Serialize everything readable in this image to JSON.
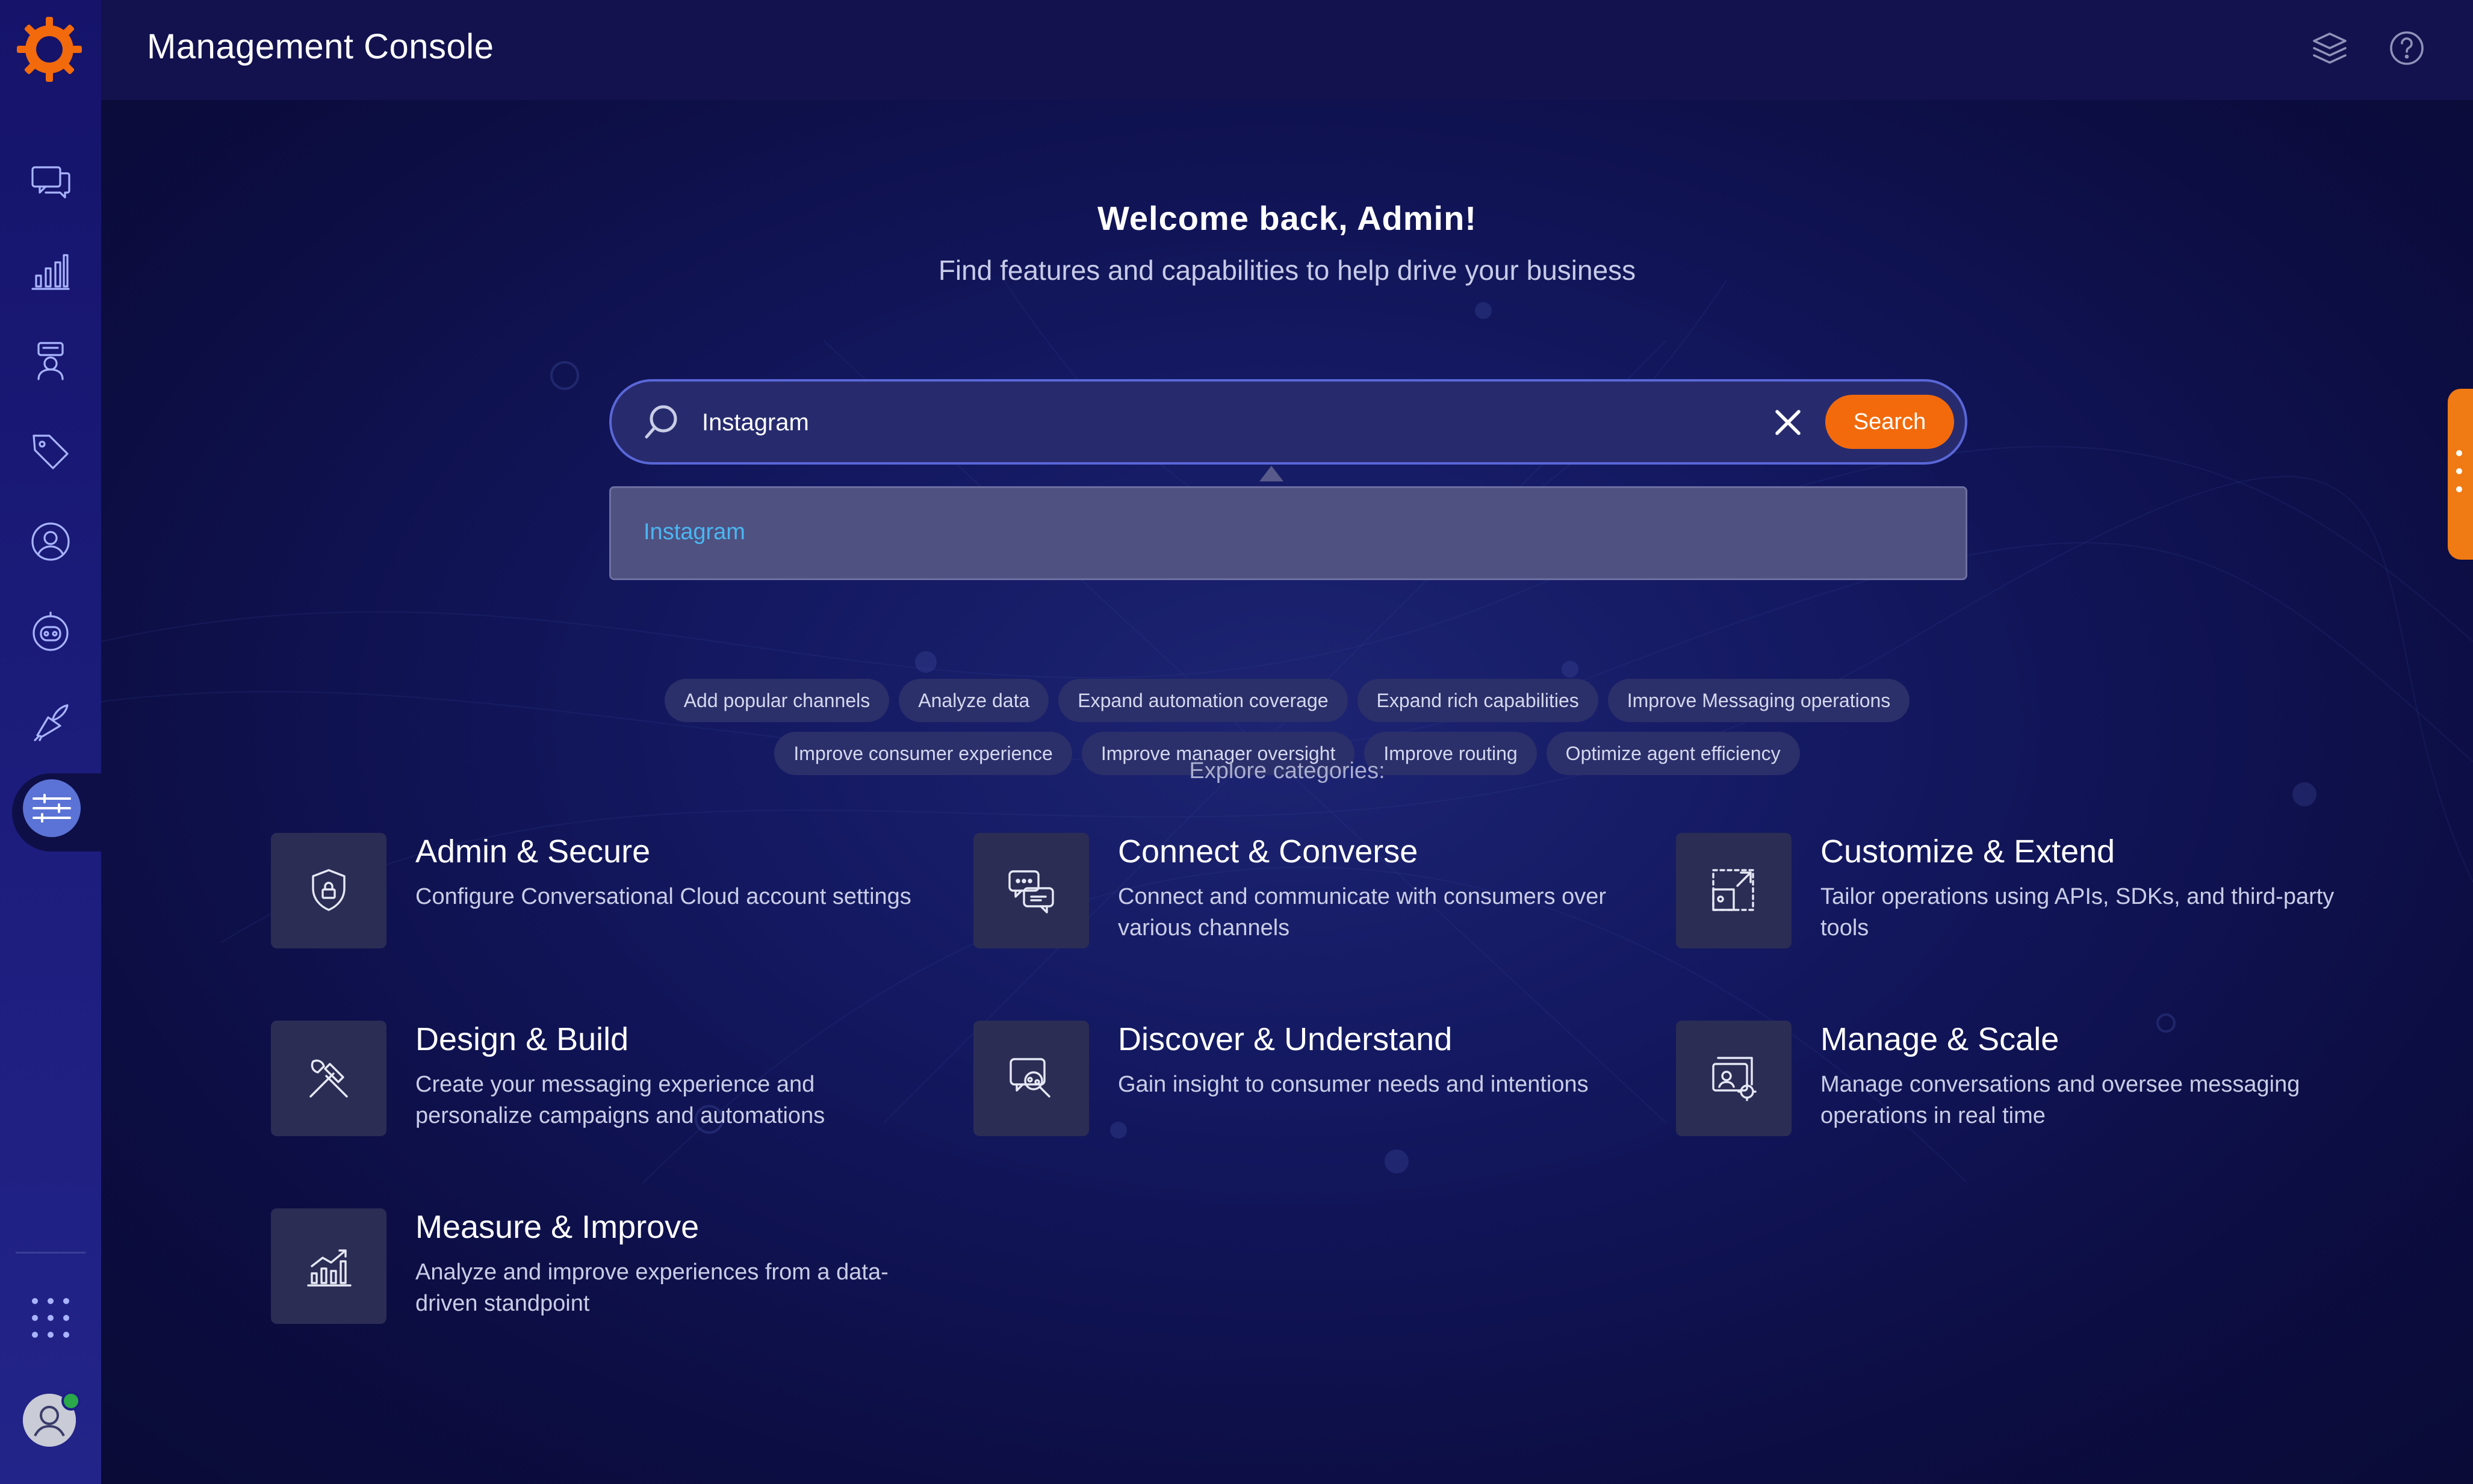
{
  "app": {
    "title": "Management Console"
  },
  "colors": {
    "accent": "#f26a0c",
    "link": "#4bb6f2",
    "sidebar": "#1a1a78",
    "background": "#0d0f3f"
  },
  "sidebar": {
    "items": [
      {
        "icon": "conversations-icon"
      },
      {
        "icon": "analytics-icon"
      },
      {
        "icon": "agent-workspace-icon"
      },
      {
        "icon": "tag-icon"
      },
      {
        "icon": "users-icon"
      },
      {
        "icon": "bot-icon"
      },
      {
        "icon": "campaigns-icon"
      },
      {
        "icon": "management-sliders-icon",
        "active": true
      }
    ],
    "bottom": [
      "apps-grid-icon",
      "user-avatar"
    ]
  },
  "topbar": {
    "icons": [
      "layers-icon",
      "help-icon"
    ]
  },
  "welcome": {
    "title": "Welcome back, Admin!",
    "subtitle": "Find features and capabilities to help drive your business"
  },
  "search": {
    "value": "Instagram",
    "placeholder": "",
    "button_label": "Search",
    "suggestions": [
      "Instagram"
    ]
  },
  "chips": {
    "row1": [
      "Add popular channels",
      "Analyze data",
      "Expand automation coverage",
      "Expand rich capabilities",
      "Improve Messaging operations"
    ],
    "row2": [
      "Improve consumer experience",
      "Improve manager oversight",
      "Improve routing",
      "Optimize agent efficiency"
    ]
  },
  "explore_label": "Explore categories:",
  "categories": [
    {
      "title": "Admin & Secure",
      "desc": "Configure Conversational Cloud account settings",
      "icon": "shield-lock-icon"
    },
    {
      "title": "Connect & Converse",
      "desc": "Connect and communicate with consumers over various channels",
      "icon": "chat-bubbles-icon"
    },
    {
      "title": "Customize & Extend",
      "desc": "Tailor operations using APIs, SDKs, and third-party tools",
      "icon": "extend-icon"
    },
    {
      "title": "Design & Build",
      "desc": "Create your messaging experience and personalize campaigns and automations",
      "icon": "tools-icon"
    },
    {
      "title": "Discover & Understand",
      "desc": "Gain insight to consumer needs and intentions",
      "icon": "insight-search-icon"
    },
    {
      "title": "Manage & Scale",
      "desc": "Manage conversations and oversee messaging operations in real time",
      "icon": "manage-settings-icon"
    },
    {
      "title": "Measure & Improve",
      "desc": "Analyze and improve experiences from a data-driven standpoint",
      "icon": "growth-chart-icon"
    }
  ]
}
